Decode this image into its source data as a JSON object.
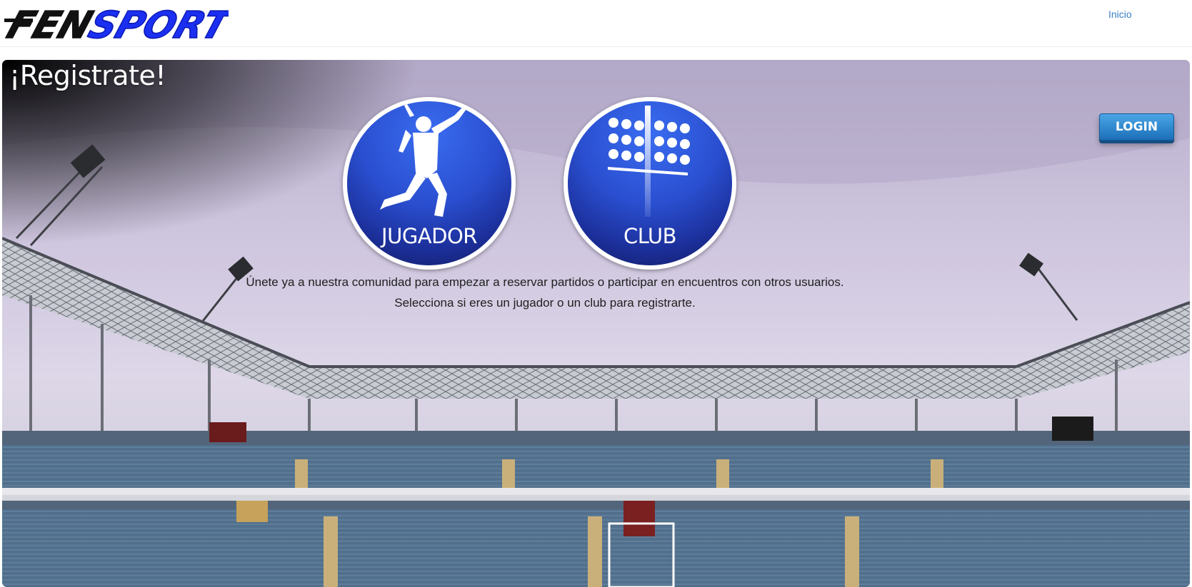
{
  "navbar": {
    "logo_text": "FENSPORT",
    "links": [
      {
        "label": "Inicio"
      }
    ]
  },
  "hero": {
    "title": "¡Registrate!",
    "login_label": "LOGIN",
    "roles": [
      {
        "label": "JUGADOR",
        "icon": "player-silhouette-icon"
      },
      {
        "label": "CLUB",
        "icon": "stadium-floodlight-icon"
      }
    ],
    "intro_line1": "Únete ya a nuestra comunidad para empezar a reservar partidos o participar en encuentros con otros usuarios.",
    "intro_line2": "Selecciona si eres un jugador o un club para registrarte."
  },
  "colors": {
    "link": "#3a7fc4",
    "login_button": "#2a86d0",
    "role_circle": "#2a4fd0",
    "logo_blue": "#1a2ff0"
  }
}
